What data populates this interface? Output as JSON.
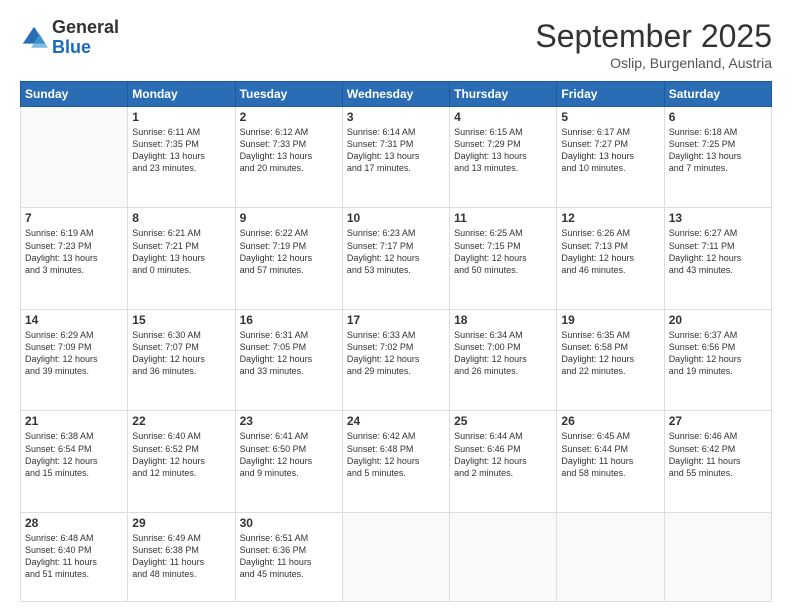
{
  "logo": {
    "general": "General",
    "blue": "Blue"
  },
  "title": {
    "month": "September 2025",
    "location": "Oslip, Burgenland, Austria"
  },
  "weekdays": [
    "Sunday",
    "Monday",
    "Tuesday",
    "Wednesday",
    "Thursday",
    "Friday",
    "Saturday"
  ],
  "weeks": [
    [
      {
        "day": "",
        "info": ""
      },
      {
        "day": "1",
        "info": "Sunrise: 6:11 AM\nSunset: 7:35 PM\nDaylight: 13 hours\nand 23 minutes."
      },
      {
        "day": "2",
        "info": "Sunrise: 6:12 AM\nSunset: 7:33 PM\nDaylight: 13 hours\nand 20 minutes."
      },
      {
        "day": "3",
        "info": "Sunrise: 6:14 AM\nSunset: 7:31 PM\nDaylight: 13 hours\nand 17 minutes."
      },
      {
        "day": "4",
        "info": "Sunrise: 6:15 AM\nSunset: 7:29 PM\nDaylight: 13 hours\nand 13 minutes."
      },
      {
        "day": "5",
        "info": "Sunrise: 6:17 AM\nSunset: 7:27 PM\nDaylight: 13 hours\nand 10 minutes."
      },
      {
        "day": "6",
        "info": "Sunrise: 6:18 AM\nSunset: 7:25 PM\nDaylight: 13 hours\nand 7 minutes."
      }
    ],
    [
      {
        "day": "7",
        "info": "Sunrise: 6:19 AM\nSunset: 7:23 PM\nDaylight: 13 hours\nand 3 minutes."
      },
      {
        "day": "8",
        "info": "Sunrise: 6:21 AM\nSunset: 7:21 PM\nDaylight: 13 hours\nand 0 minutes."
      },
      {
        "day": "9",
        "info": "Sunrise: 6:22 AM\nSunset: 7:19 PM\nDaylight: 12 hours\nand 57 minutes."
      },
      {
        "day": "10",
        "info": "Sunrise: 6:23 AM\nSunset: 7:17 PM\nDaylight: 12 hours\nand 53 minutes."
      },
      {
        "day": "11",
        "info": "Sunrise: 6:25 AM\nSunset: 7:15 PM\nDaylight: 12 hours\nand 50 minutes."
      },
      {
        "day": "12",
        "info": "Sunrise: 6:26 AM\nSunset: 7:13 PM\nDaylight: 12 hours\nand 46 minutes."
      },
      {
        "day": "13",
        "info": "Sunrise: 6:27 AM\nSunset: 7:11 PM\nDaylight: 12 hours\nand 43 minutes."
      }
    ],
    [
      {
        "day": "14",
        "info": "Sunrise: 6:29 AM\nSunset: 7:09 PM\nDaylight: 12 hours\nand 39 minutes."
      },
      {
        "day": "15",
        "info": "Sunrise: 6:30 AM\nSunset: 7:07 PM\nDaylight: 12 hours\nand 36 minutes."
      },
      {
        "day": "16",
        "info": "Sunrise: 6:31 AM\nSunset: 7:05 PM\nDaylight: 12 hours\nand 33 minutes."
      },
      {
        "day": "17",
        "info": "Sunrise: 6:33 AM\nSunset: 7:02 PM\nDaylight: 12 hours\nand 29 minutes."
      },
      {
        "day": "18",
        "info": "Sunrise: 6:34 AM\nSunset: 7:00 PM\nDaylight: 12 hours\nand 26 minutes."
      },
      {
        "day": "19",
        "info": "Sunrise: 6:35 AM\nSunset: 6:58 PM\nDaylight: 12 hours\nand 22 minutes."
      },
      {
        "day": "20",
        "info": "Sunrise: 6:37 AM\nSunset: 6:56 PM\nDaylight: 12 hours\nand 19 minutes."
      }
    ],
    [
      {
        "day": "21",
        "info": "Sunrise: 6:38 AM\nSunset: 6:54 PM\nDaylight: 12 hours\nand 15 minutes."
      },
      {
        "day": "22",
        "info": "Sunrise: 6:40 AM\nSunset: 6:52 PM\nDaylight: 12 hours\nand 12 minutes."
      },
      {
        "day": "23",
        "info": "Sunrise: 6:41 AM\nSunset: 6:50 PM\nDaylight: 12 hours\nand 9 minutes."
      },
      {
        "day": "24",
        "info": "Sunrise: 6:42 AM\nSunset: 6:48 PM\nDaylight: 12 hours\nand 5 minutes."
      },
      {
        "day": "25",
        "info": "Sunrise: 6:44 AM\nSunset: 6:46 PM\nDaylight: 12 hours\nand 2 minutes."
      },
      {
        "day": "26",
        "info": "Sunrise: 6:45 AM\nSunset: 6:44 PM\nDaylight: 11 hours\nand 58 minutes."
      },
      {
        "day": "27",
        "info": "Sunrise: 6:46 AM\nSunset: 6:42 PM\nDaylight: 11 hours\nand 55 minutes."
      }
    ],
    [
      {
        "day": "28",
        "info": "Sunrise: 6:48 AM\nSunset: 6:40 PM\nDaylight: 11 hours\nand 51 minutes."
      },
      {
        "day": "29",
        "info": "Sunrise: 6:49 AM\nSunset: 6:38 PM\nDaylight: 11 hours\nand 48 minutes."
      },
      {
        "day": "30",
        "info": "Sunrise: 6:51 AM\nSunset: 6:36 PM\nDaylight: 11 hours\nand 45 minutes."
      },
      {
        "day": "",
        "info": ""
      },
      {
        "day": "",
        "info": ""
      },
      {
        "day": "",
        "info": ""
      },
      {
        "day": "",
        "info": ""
      }
    ]
  ]
}
